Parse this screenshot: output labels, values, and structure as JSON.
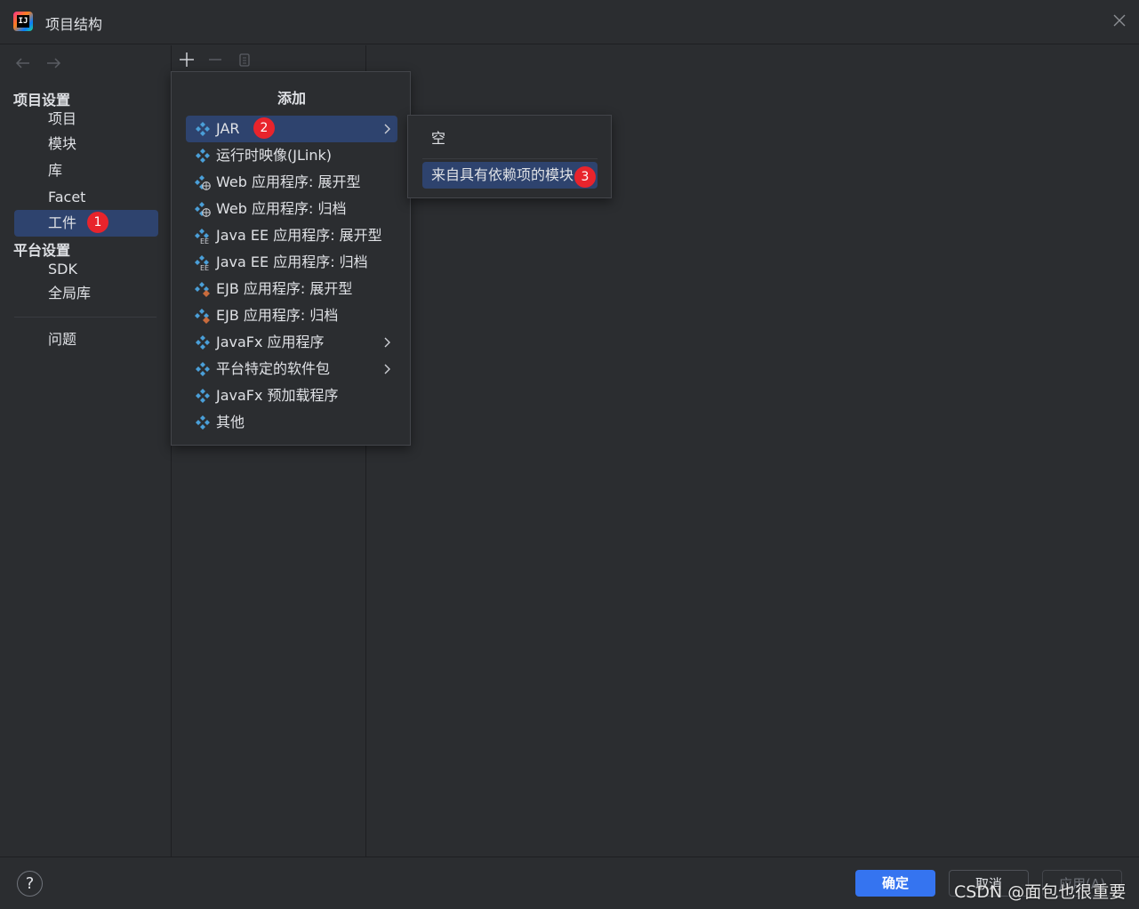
{
  "window": {
    "title": "项目结构",
    "logo_text": "IJ"
  },
  "sidebar": {
    "project_settings_title": "项目设置",
    "project_items": [
      {
        "label": "项目"
      },
      {
        "label": "模块"
      },
      {
        "label": "库"
      },
      {
        "label": "Facet"
      },
      {
        "label": "工件",
        "selected": true,
        "badge": "1"
      }
    ],
    "platform_settings_title": "平台设置",
    "platform_items": [
      {
        "label": "SDK"
      },
      {
        "label": "全局库"
      }
    ],
    "problems_label": "问题"
  },
  "add_popup": {
    "title": "添加",
    "items": [
      {
        "label": "JAR",
        "icon": "diamond-icon",
        "selected": true,
        "submenu": true,
        "badge": "2"
      },
      {
        "label": "运行时映像(JLink)",
        "icon": "diamond-icon"
      },
      {
        "label": "Web 应用程序: 展开型",
        "icon": "web-diamond-icon"
      },
      {
        "label": "Web 应用程序: 归档",
        "icon": "web-diamond-icon"
      },
      {
        "label": "Java EE 应用程序: 展开型",
        "icon": "javaee-diamond-icon"
      },
      {
        "label": "Java EE 应用程序: 归档",
        "icon": "javaee-diamond-icon"
      },
      {
        "label": "EJB 应用程序: 展开型",
        "icon": "ejb-diamond-icon"
      },
      {
        "label": "EJB 应用程序: 归档",
        "icon": "ejb-diamond-icon"
      },
      {
        "label": "JavaFx 应用程序",
        "icon": "diamond-icon",
        "submenu": true
      },
      {
        "label": "平台特定的软件包",
        "icon": "diamond-icon",
        "submenu": true
      },
      {
        "label": "JavaFx 预加载程序",
        "icon": "diamond-icon"
      },
      {
        "label": "其他",
        "icon": "diamond-icon"
      }
    ]
  },
  "jar_submenu": {
    "items": [
      {
        "label": "空"
      },
      {
        "label": "来自具有依赖项的模块",
        "selected": true,
        "badge": "3"
      }
    ]
  },
  "footer": {
    "help_label": "?",
    "ok_label": "确定",
    "cancel_label": "取消",
    "apply_label": "应用(A)"
  },
  "watermark": "CSDN @面包也很重要",
  "colors": {
    "background": "#2b2d30",
    "selection": "#2e436e",
    "primary_button": "#3574f0",
    "badge": "#e8242c",
    "icon_blue": "#4a9fd8"
  }
}
